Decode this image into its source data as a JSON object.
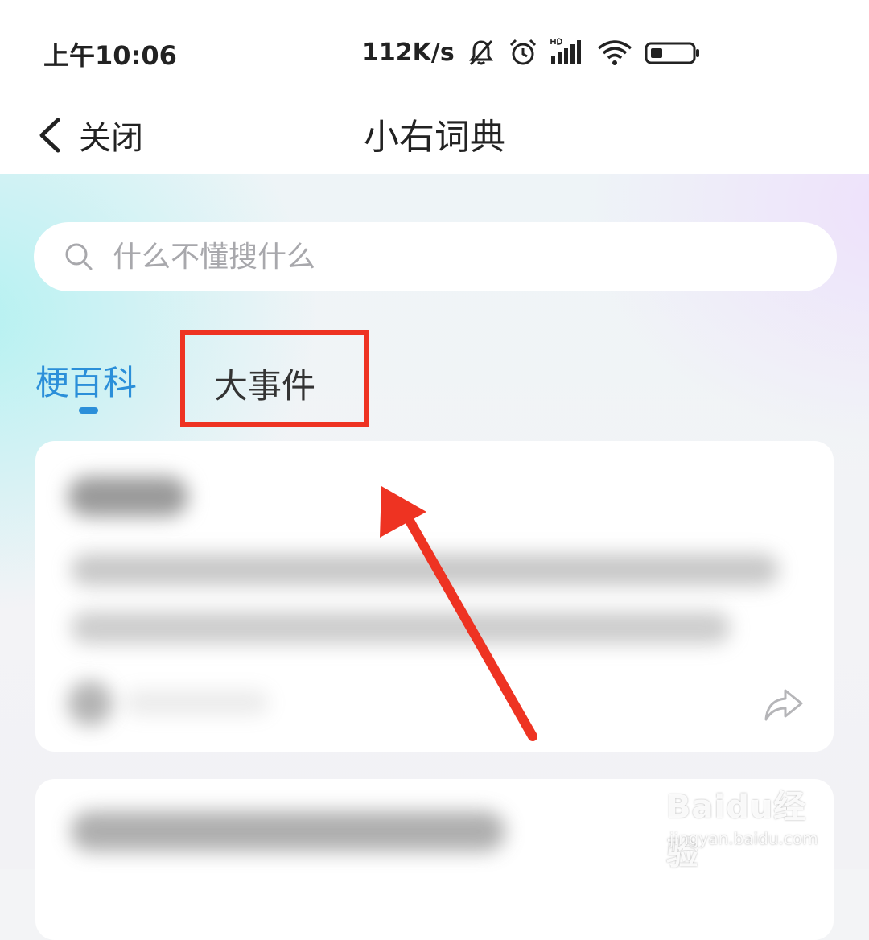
{
  "status_bar": {
    "time": "上午10:06",
    "net_speed": "112K/s",
    "icons": [
      "bell-muted-icon",
      "alarm-clock-icon",
      "hd-signal-icon",
      "wifi-icon",
      "battery-icon"
    ]
  },
  "nav": {
    "back_label": "关闭",
    "title": "小右词典"
  },
  "search": {
    "placeholder": "什么不懂搜什么"
  },
  "tabs": [
    {
      "label": "梗百科",
      "active": true
    },
    {
      "label": "大事件",
      "active": false
    }
  ],
  "colors": {
    "accent": "#2b8fd9",
    "annotation": "#ee3322"
  },
  "watermark": {
    "logo": "Baidu经验",
    "url": "jingyan.baidu.com"
  }
}
